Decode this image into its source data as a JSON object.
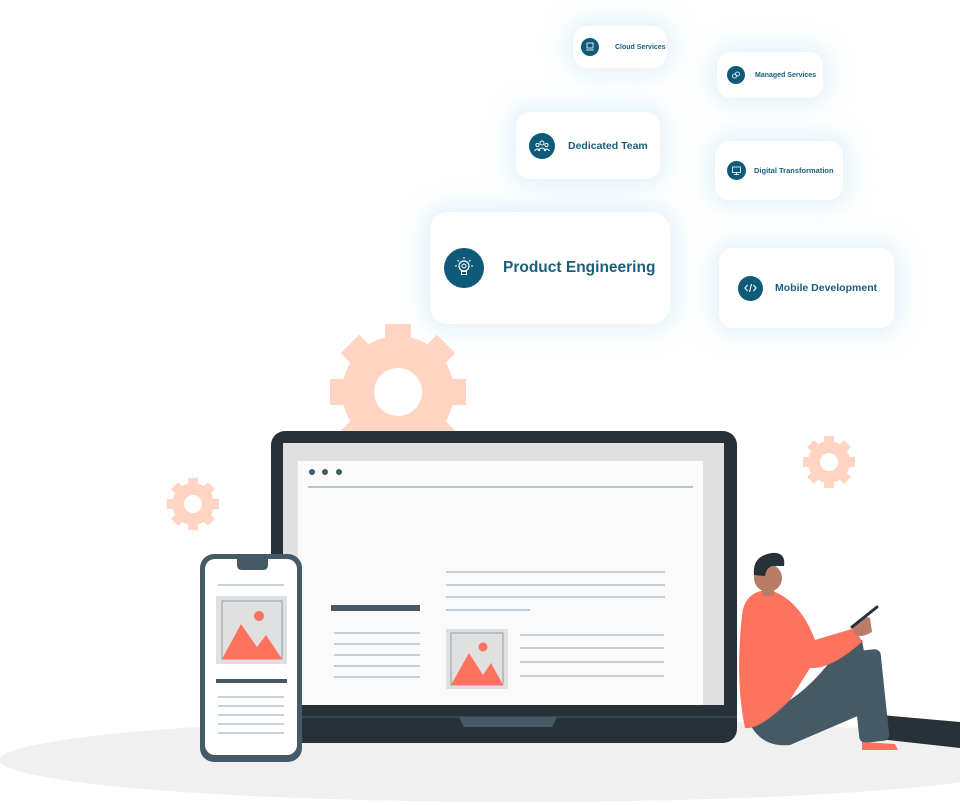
{
  "services": [
    {
      "label": "Cloud Services",
      "icon": "cloud-server-icon"
    },
    {
      "label": "Managed Services",
      "icon": "gears-icon"
    },
    {
      "label": "Dedicated Team",
      "icon": "team-icon"
    },
    {
      "label": "Digital Transformation",
      "icon": "monitor-transform-icon"
    },
    {
      "label": "Product Engineering",
      "icon": "lightbulb-gear-icon"
    },
    {
      "label": "Mobile Development",
      "icon": "code-icon"
    }
  ],
  "colors": {
    "brand": "#0f5a78",
    "label": "#1b5f7c",
    "accent": "#ff725e",
    "gear": "#ffd4c2",
    "device_dark": "#263238",
    "device_mid": "#455a64"
  }
}
